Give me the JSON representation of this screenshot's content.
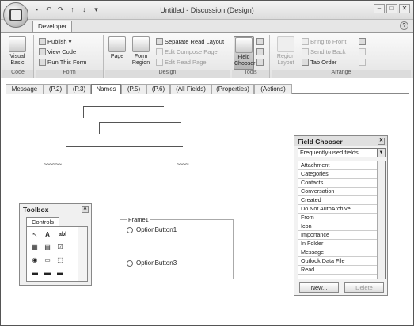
{
  "window": {
    "title": "Untitled - Discussion  (Design)"
  },
  "ribbon_tab": "Developer",
  "groups": {
    "code": {
      "label": "Code",
      "visual_basic": "Visual Basic"
    },
    "form": {
      "label": "Form",
      "publish": "Publish ▾",
      "view_code": "View Code",
      "run_form": "Run This Form"
    },
    "design": {
      "label": "Design",
      "page": "Page",
      "form_region": "Form Region",
      "separate_read_layout": "Separate Read Layout",
      "edit_compose_page": "Edit Compose Page",
      "edit_read_page": "Edit Read Page"
    },
    "tools": {
      "label": "Tools",
      "field_chooser": "Field Chooser"
    },
    "arrange": {
      "label": "Arrange",
      "region_layout": "Region Layout",
      "bring_to_front": "Bring to Front",
      "send_to_back": "Send to Back",
      "tab_order": "Tab Order"
    }
  },
  "form_tabs": [
    "Message",
    "(P.2)",
    "(P.3)",
    "Names",
    "(P.5)",
    "(P.6)",
    "(All Fields)",
    "(Properties)",
    "(Actions)"
  ],
  "active_form_tab": "Names",
  "toolbox": {
    "title": "Toolbox",
    "tab": "Controls"
  },
  "frame": {
    "legend": "Frame1",
    "option1": "OptionButton1",
    "option2": "OptionButton3"
  },
  "field_chooser": {
    "title": "Field Chooser",
    "selected": "Frequently-used fields",
    "items": [
      "Attachment",
      "Categories",
      "Contacts",
      "Conversation",
      "Created",
      "Do Not AutoArchive",
      "From",
      "Icon",
      "Importance",
      "In Folder",
      "Message",
      "Outlook Data File",
      "Read"
    ],
    "new_button": "New...",
    "delete_button": "Delete"
  }
}
